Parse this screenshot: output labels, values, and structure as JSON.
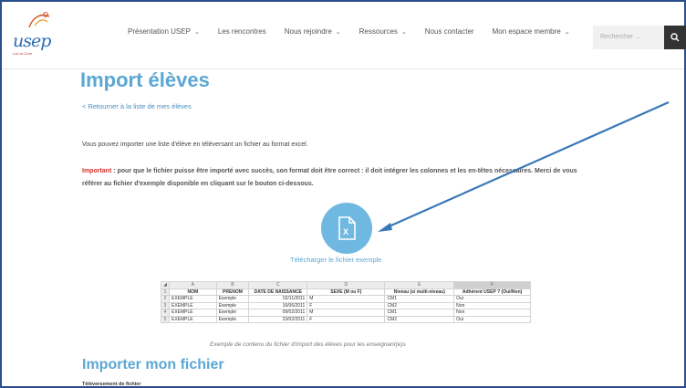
{
  "brand": {
    "logo_text": "usep",
    "logo_sub": "Loir-et-Cher"
  },
  "nav": {
    "items": [
      {
        "label": "Présentation USEP",
        "has_dropdown": true
      },
      {
        "label": "Les rencontres",
        "has_dropdown": false
      },
      {
        "label": "Nous rejoindre",
        "has_dropdown": true
      },
      {
        "label": "Ressources",
        "has_dropdown": true
      },
      {
        "label": "Nous contacter",
        "has_dropdown": false
      },
      {
        "label": "Mon espace membre",
        "has_dropdown": true
      }
    ],
    "search_placeholder": "Rechercher ..."
  },
  "page": {
    "title": "Import élèves",
    "back_link": "< Retourner à la liste de mes élèves",
    "intro": "Vous pouvez importer une liste d'élève en téléversant un fichier au format excel.",
    "important_label": "Important",
    "important_text": " : pour que le fichier puisse être importé avec succès, son format doit être correct : il doit intégrer les colonnes et les en-têtes nécessaires. Merci de vous référer au fichier d'exemple disponible en cliquant sur le bouton ci-dessous.",
    "download_label": "Télécharger le fichier exemple",
    "caption": "Exemple de contenu du fichier d'import des élèves pour les enseignant(e)s",
    "section_title": "Importer mon fichier",
    "upload_label": "Téléversement de fichier"
  },
  "sheet": {
    "col_letters": [
      "A",
      "B",
      "C",
      "D",
      "E",
      "F"
    ],
    "headers": [
      "NOM",
      "PRENOM",
      "DATE DE NAISSANCE",
      "SEXE (M ou F)",
      "Niveau (si multi-niveau)",
      "Adhérent USEP ? (Oui/Non)"
    ],
    "rows": [
      {
        "num": "2",
        "cells": [
          "EXEMPLE",
          "Exemple",
          "02/11/2011",
          "M",
          "CM1",
          "Oui"
        ]
      },
      {
        "num": "3",
        "cells": [
          "EXEMPLE",
          "Exemple",
          "16/06/2011",
          "F",
          "CM2",
          "Non"
        ]
      },
      {
        "num": "4",
        "cells": [
          "EXEMPLE",
          "Exemple",
          "09/02/2011",
          "M",
          "CM1",
          "Non"
        ]
      },
      {
        "num": "5",
        "cells": [
          "EXEMPLE",
          "Exemple",
          "23/02/2011",
          "F",
          "CM2",
          "Oui"
        ]
      }
    ]
  },
  "colors": {
    "accent": "#5ba7d3",
    "important": "#d0312d",
    "arrow": "#3a78b8"
  }
}
